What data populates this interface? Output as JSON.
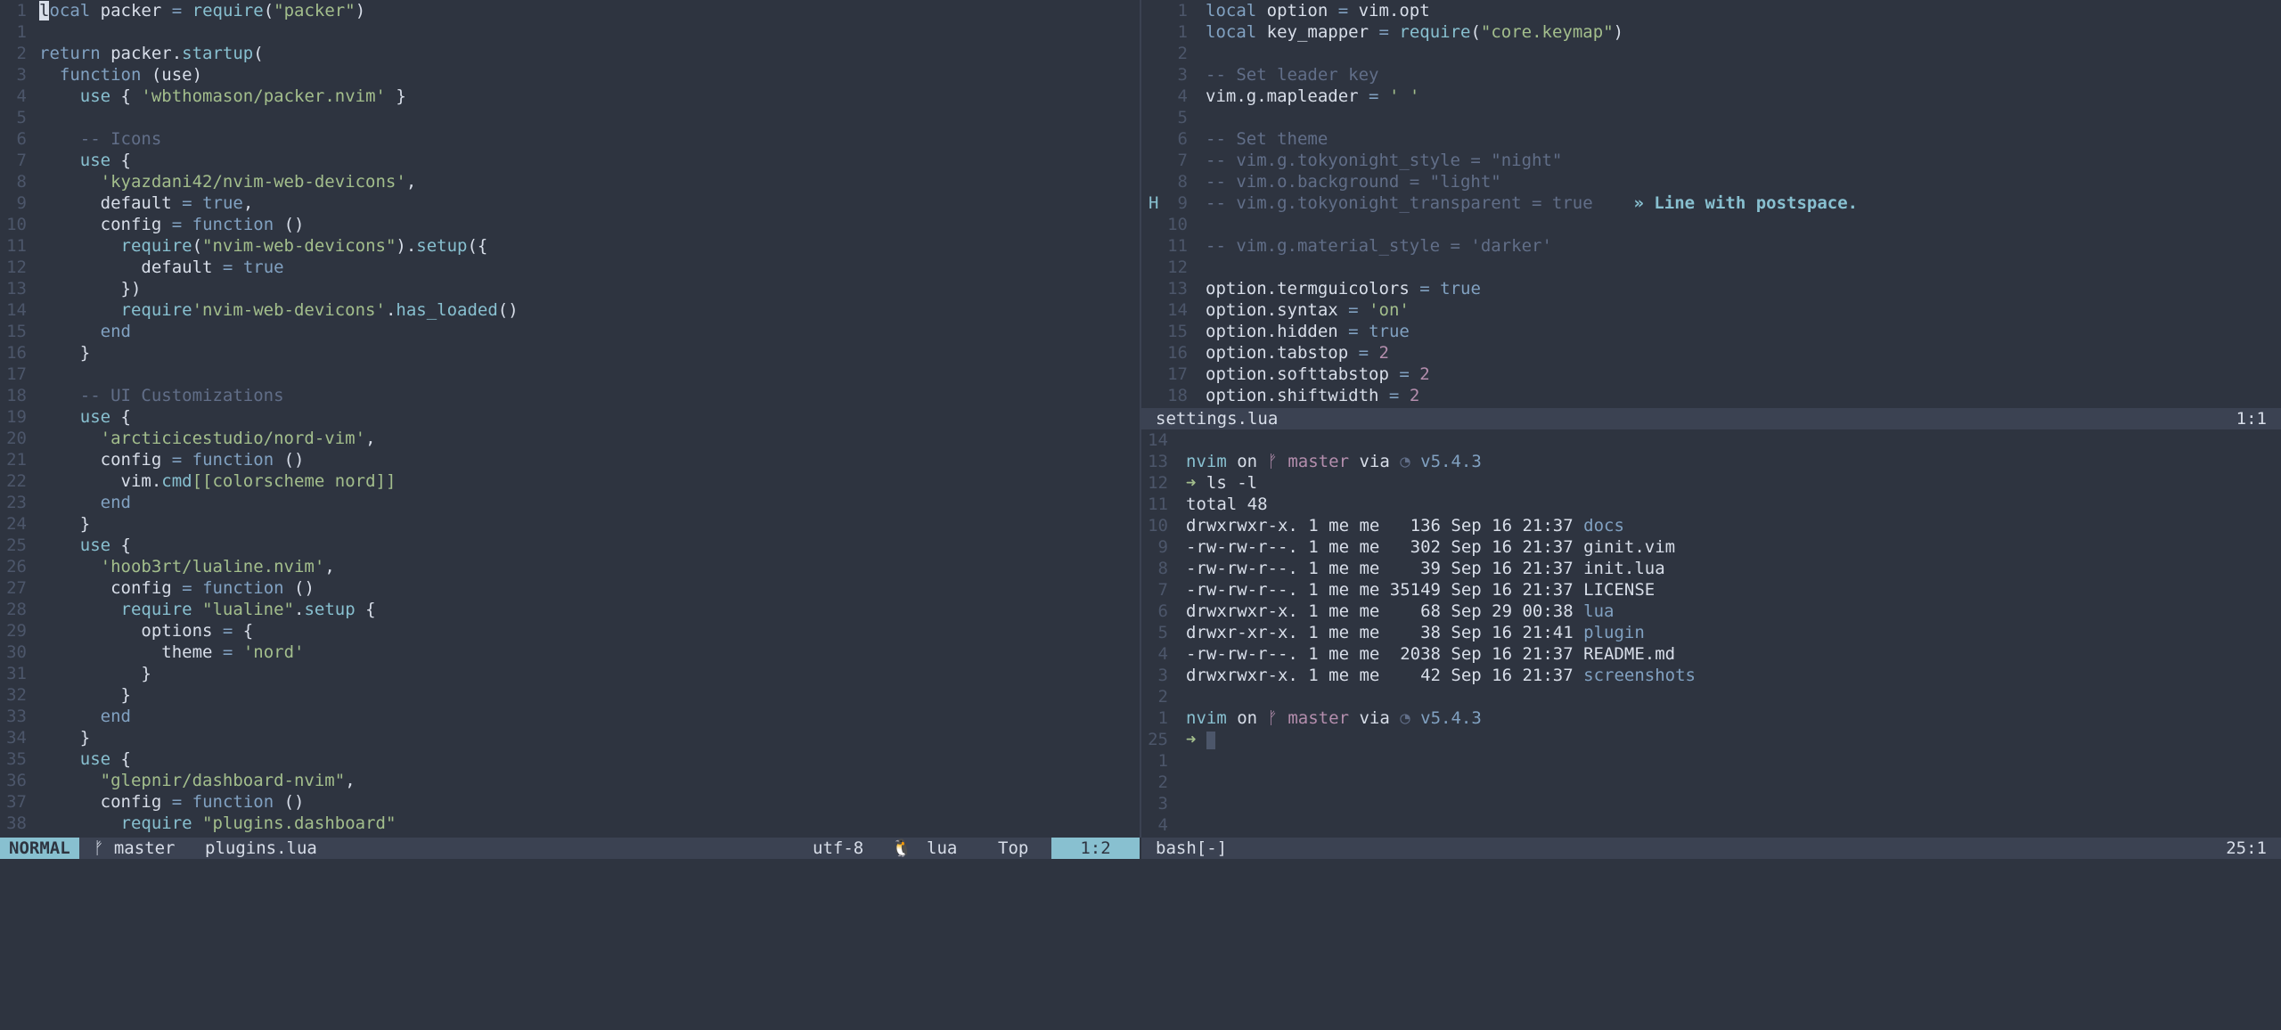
{
  "left": {
    "file_label": "plugins.lua",
    "lines": [
      {
        "n": "1",
        "html": "<span class=\"kw\"><span class=\"cursor\">l</span>ocal</span> packer <span class=\"op\">=</span> <span class=\"fn\">require</span>(<span class=\"str\">\"packer\"</span>)"
      },
      {
        "n": "1",
        "html": ""
      },
      {
        "n": "2",
        "html": "<span class=\"kw\">return</span> packer.<span class=\"fn\">startup</span>("
      },
      {
        "n": "3",
        "html": "  <span class=\"kw\">function</span> (use)"
      },
      {
        "n": "4",
        "html": "    <span class=\"fn\">use</span> { <span class=\"str\">'wbthomason/packer.nvim'</span> }"
      },
      {
        "n": "5",
        "html": ""
      },
      {
        "n": "6",
        "html": "    <span class=\"cm\">-- Icons</span>"
      },
      {
        "n": "7",
        "html": "    <span class=\"fn\">use</span> {"
      },
      {
        "n": "8",
        "html": "      <span class=\"str\">'kyazdani42/nvim-web-devicons'</span>,"
      },
      {
        "n": "9",
        "html": "      default <span class=\"op\">=</span> <span class=\"kw\">true</span>,"
      },
      {
        "n": "10",
        "html": "      config <span class=\"op\">=</span> <span class=\"kw\">function</span> ()"
      },
      {
        "n": "11",
        "html": "        <span class=\"fn\">require</span>(<span class=\"str\">\"nvim-web-devicons\"</span>).<span class=\"fn\">setup</span>({"
      },
      {
        "n": "12",
        "html": "          default <span class=\"op\">=</span> <span class=\"kw\">true</span>"
      },
      {
        "n": "13",
        "html": "        })"
      },
      {
        "n": "14",
        "html": "        <span class=\"fn\">require</span><span class=\"str\">'nvim-web-devicons'</span>.<span class=\"fn\">has_loaded</span>()"
      },
      {
        "n": "15",
        "html": "      <span class=\"kw\">end</span>"
      },
      {
        "n": "16",
        "html": "    }"
      },
      {
        "n": "17",
        "html": ""
      },
      {
        "n": "18",
        "html": "    <span class=\"cm\">-- UI Customizations</span>"
      },
      {
        "n": "19",
        "html": "    <span class=\"fn\">use</span> {"
      },
      {
        "n": "20",
        "html": "      <span class=\"str\">'arcticicestudio/nord-vim'</span>,"
      },
      {
        "n": "21",
        "html": "      config <span class=\"op\">=</span> <span class=\"kw\">function</span> ()"
      },
      {
        "n": "22",
        "html": "        vim.<span class=\"fn\">cmd</span><span class=\"str\">[[colorscheme nord]]</span>"
      },
      {
        "n": "23",
        "html": "      <span class=\"kw\">end</span>"
      },
      {
        "n": "24",
        "html": "    }"
      },
      {
        "n": "25",
        "html": "    <span class=\"fn\">use</span> {"
      },
      {
        "n": "26",
        "html": "      <span class=\"str\">'hoob3rt/lualine.nvim'</span>,"
      },
      {
        "n": "27",
        "html": "       config <span class=\"op\">=</span> <span class=\"kw\">function</span> ()"
      },
      {
        "n": "28",
        "html": "        <span class=\"fn\">require</span> <span class=\"str\">\"lualine\"</span>.<span class=\"fn\">setup</span> {"
      },
      {
        "n": "29",
        "html": "          options <span class=\"op\">=</span> {"
      },
      {
        "n": "30",
        "html": "            theme <span class=\"op\">=</span> <span class=\"str\">'nord'</span>"
      },
      {
        "n": "31",
        "html": "          }"
      },
      {
        "n": "32",
        "html": "        }"
      },
      {
        "n": "33",
        "html": "      <span class=\"kw\">end</span>"
      },
      {
        "n": "34",
        "html": "    }"
      },
      {
        "n": "35",
        "html": "    <span class=\"fn\">use</span> {"
      },
      {
        "n": "36",
        "html": "      <span class=\"str\">\"glepnir/dashboard-nvim\"</span>,"
      },
      {
        "n": "37",
        "html": "      config <span class=\"op\">=</span> <span class=\"kw\">function</span> ()"
      },
      {
        "n": "38",
        "html": "        <span class=\"fn\">require</span> <span class=\"str\">\"plugins.dashboard\"</span>"
      }
    ],
    "status": {
      "mode": "NORMAL",
      "branch": "ᚠ master",
      "file": "plugins.lua",
      "encoding": "utf-8",
      "os_icon": "🐧",
      "filetype": "lua",
      "position": "Top",
      "cursor": "1:2"
    }
  },
  "top_right": {
    "lines": [
      {
        "s": "",
        "n": "1",
        "html": "<span class=\"kw\">local</span> option <span class=\"op\">=</span> vim.opt"
      },
      {
        "s": "",
        "n": "1",
        "html": "<span class=\"kw\">local</span> key_mapper <span class=\"op\">=</span> <span class=\"fn\">require</span>(<span class=\"str\">\"core.keymap\"</span>)"
      },
      {
        "s": "",
        "n": "2",
        "html": ""
      },
      {
        "s": "",
        "n": "3",
        "html": "<span class=\"cm\">-- Set leader key</span>"
      },
      {
        "s": "",
        "n": "4",
        "html": "vim.g.mapleader <span class=\"op\">=</span> <span class=\"str\">' '</span>"
      },
      {
        "s": "",
        "n": "5",
        "html": ""
      },
      {
        "s": "",
        "n": "6",
        "html": "<span class=\"cm\">-- Set theme</span>"
      },
      {
        "s": "",
        "n": "7",
        "html": "<span class=\"cm\">-- vim.g.tokyonight_style = \"night\"</span>"
      },
      {
        "s": "",
        "n": "8",
        "html": "<span class=\"cm\">-- vim.o.background = \"light\"</span>"
      },
      {
        "s": "H",
        "n": "9",
        "html": "<span class=\"cm\">-- vim.g.tokyonight_transparent = true</span>    <span class=\"virt\">» Line with postspace.</span>"
      },
      {
        "s": "",
        "n": "10",
        "html": ""
      },
      {
        "s": "",
        "n": "11",
        "html": "<span class=\"cm\">-- vim.g.material_style = 'darker'</span>"
      },
      {
        "s": "",
        "n": "12",
        "html": ""
      },
      {
        "s": "",
        "n": "13",
        "html": "option.termguicolors <span class=\"op\">=</span> <span class=\"kw\">true</span>"
      },
      {
        "s": "",
        "n": "14",
        "html": "option.syntax <span class=\"op\">=</span> <span class=\"str\">'on'</span>"
      },
      {
        "s": "",
        "n": "15",
        "html": "option.hidden <span class=\"op\">=</span> <span class=\"kw\">true</span>"
      },
      {
        "s": "",
        "n": "16",
        "html": "option.tabstop <span class=\"op\">=</span> <span class=\"num-lit\">2</span>"
      },
      {
        "s": "",
        "n": "17",
        "html": "option.softtabstop <span class=\"op\">=</span> <span class=\"num-lit\">2</span>"
      },
      {
        "s": "",
        "n": "18",
        "html": "option.shiftwidth <span class=\"op\">=</span> <span class=\"num-lit\">2</span>"
      }
    ],
    "status": {
      "file": "settings.lua",
      "cursor": "1:1"
    }
  },
  "terminal": {
    "lines": [
      {
        "n": "14",
        "html": ""
      },
      {
        "n": "13",
        "html": "<span class=\"fn\">nvim</span> on <span class=\"branch\">ᚠ master</span> via <span class=\"cm\">◔</span> <span class=\"ver\">v5.4.3</span>"
      },
      {
        "n": "12",
        "html": "<span class=\"prompt\">➜</span> ls -l"
      },
      {
        "n": "11",
        "html": "total 48"
      },
      {
        "n": "10",
        "html": "drwxrwxr-x. 1 me me   136 Sep 16 21:37 <span class=\"dir\">docs</span>"
      },
      {
        "n": "9",
        "html": "-rw-rw-r--. 1 me me   302 Sep 16 21:37 ginit.vim"
      },
      {
        "n": "8",
        "html": "-rw-rw-r--. 1 me me    39 Sep 16 21:37 init.lua"
      },
      {
        "n": "7",
        "html": "-rw-rw-r--. 1 me me 35149 Sep 16 21:37 LICENSE"
      },
      {
        "n": "6",
        "html": "drwxrwxr-x. 1 me me    68 Sep 29 00:38 <span class=\"dir\">lua</span>"
      },
      {
        "n": "5",
        "html": "drwxr-xr-x. 1 me me    38 Sep 16 21:41 <span class=\"dir\">plugin</span>"
      },
      {
        "n": "4",
        "html": "-rw-rw-r--. 1 me me  2038 Sep 16 21:37 README.md"
      },
      {
        "n": "3",
        "html": "drwxrwxr-x. 1 me me    42 Sep 16 21:37 <span class=\"dir\">screenshots</span>"
      },
      {
        "n": "2",
        "html": ""
      },
      {
        "n": "1",
        "html": "<span class=\"fn\">nvim</span> on <span class=\"branch\">ᚠ master</span> via <span class=\"cm\">◔</span> <span class=\"ver\">v5.4.3</span>"
      },
      {
        "n": "25",
        "html": "<span class=\"prompt\">➜</span> <span class=\"tcursor\"></span>"
      },
      {
        "n": "1",
        "html": ""
      },
      {
        "n": "2",
        "html": ""
      },
      {
        "n": "3",
        "html": ""
      },
      {
        "n": "4",
        "html": ""
      }
    ],
    "status": {
      "file": "bash[-]",
      "cursor": "25:1"
    }
  }
}
